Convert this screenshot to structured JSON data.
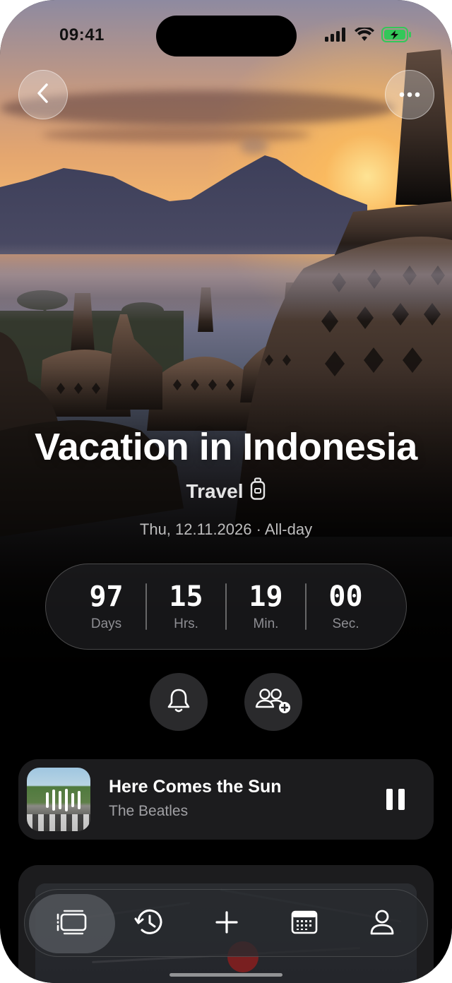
{
  "status_bar": {
    "time": "09:41",
    "icons": [
      "cellular-signal-icon",
      "wifi-icon",
      "battery-charging-icon"
    ]
  },
  "header": {
    "back_icon": "chevron-left-icon",
    "more_icon": "ellipsis-icon"
  },
  "event": {
    "title": "Vacation in Indonesia",
    "category": "Travel",
    "category_icon": "luggage-icon",
    "date": "Thu, 12.11.2026 · All-day"
  },
  "countdown": {
    "units": [
      {
        "value": "97",
        "label": "Days"
      },
      {
        "value": "15",
        "label": "Hrs."
      },
      {
        "value": "19",
        "label": "Min."
      },
      {
        "value": "00",
        "label": "Sec."
      }
    ]
  },
  "actions": {
    "reminder_icon": "bell-icon",
    "invite_icon": "add-people-icon"
  },
  "now_playing": {
    "title": "Here Comes the Sun",
    "artist": "The Beatles",
    "state_icon": "pause-icon"
  },
  "tab_bar": {
    "tabs": [
      "events-list-icon",
      "history-icon",
      "plus-icon",
      "calendar-icon",
      "profile-icon"
    ],
    "active_index": 0
  },
  "colors": {
    "background": "#000000",
    "card": "#1c1c1e",
    "battery": "#34c759",
    "secondary_text": "#8e8e93"
  }
}
